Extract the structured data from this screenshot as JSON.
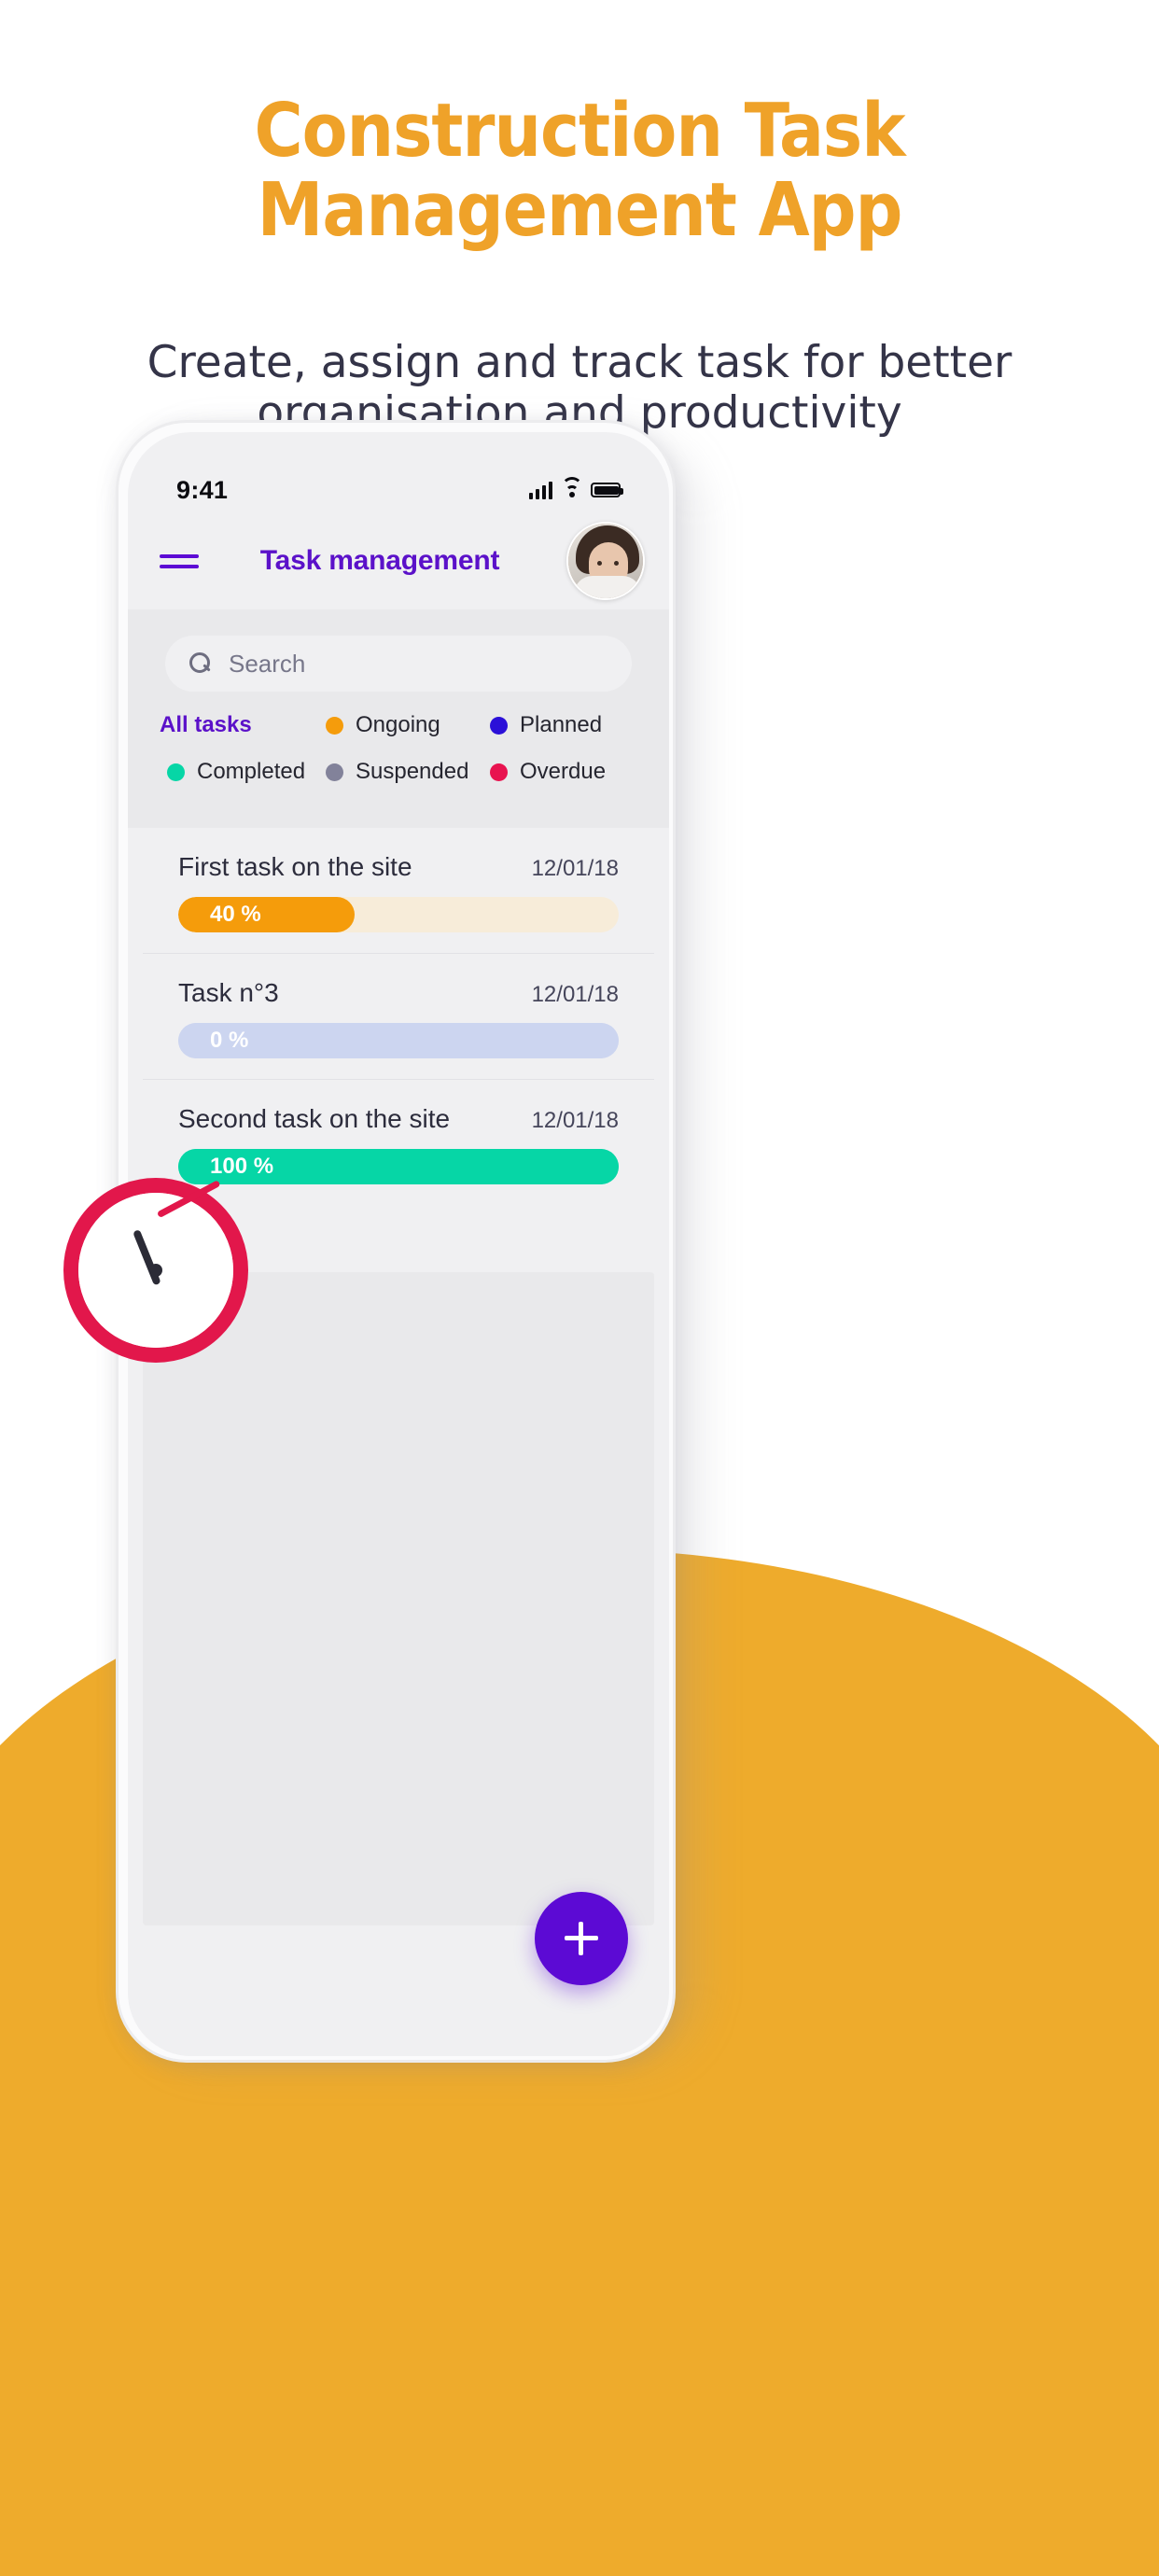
{
  "promo": {
    "title": "Construction Task\nManagement App",
    "subtitle": "Create, assign and track task for better\norganisation and productivity",
    "title_color": "#efa229",
    "subtitle_color": "#343448"
  },
  "phone": {
    "status_bar": {
      "time": "9:41",
      "icons": [
        "signal-icon",
        "wifi-icon",
        "battery-icon"
      ]
    },
    "app_bar": {
      "menu_icon": "hamburger-menu-icon",
      "title": "Task management",
      "avatar": "user-avatar"
    },
    "search": {
      "icon": "search-icon",
      "placeholder": "Search"
    },
    "legend": [
      {
        "label": "All tasks",
        "color": "#5b11c9",
        "active": true,
        "has_dot": false
      },
      {
        "label": "Ongoing",
        "color": "#f59c0b",
        "active": false,
        "has_dot": true
      },
      {
        "label": "Planned",
        "color": "#2b10d8",
        "active": false,
        "has_dot": true
      },
      {
        "label": "Completed",
        "color": "#06d6a6",
        "active": false,
        "has_dot": true
      },
      {
        "label": "Suspended",
        "color": "#82829a",
        "active": false,
        "has_dot": true
      },
      {
        "label": "Overdue",
        "color": "#e8134f",
        "active": false,
        "has_dot": true
      }
    ],
    "tasks": [
      {
        "title": "First task on the site",
        "date": "12/01/18",
        "percent_label": "40 %",
        "percent": 40,
        "fill_color": "#f59c0b",
        "track_color": "#f7ecd9"
      },
      {
        "title": "Task n°3",
        "date": "12/01/18",
        "percent_label": "0 %",
        "percent": 100,
        "fill_color": "#ccd5f0",
        "track_color": "#ccd5f0"
      },
      {
        "title": "Second task on the site",
        "date": "12/01/18",
        "percent_label": "100 %",
        "percent": 100,
        "fill_color": "#06d6a6",
        "track_color": "#06d6a6"
      }
    ],
    "fab": {
      "icon": "plus-icon",
      "color": "#5c0ad4"
    }
  },
  "decor": {
    "arc_color": "#eeab2c",
    "clock_ring_color": "#e2174b",
    "clock_name": "clock-graphic"
  }
}
